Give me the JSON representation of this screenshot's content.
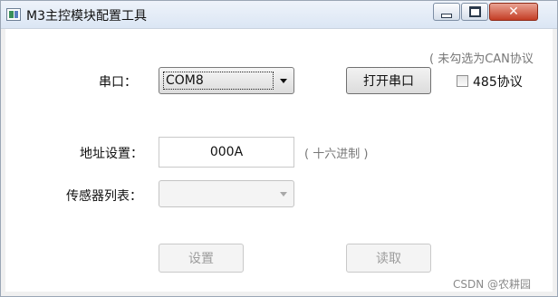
{
  "window": {
    "title": "M3主控模块配置工具",
    "controls": {
      "minimize": "minimize",
      "maximize": "maximize",
      "close": "✕"
    }
  },
  "form": {
    "protocol_hint": "( 未勾选为CAN协议",
    "serial_port": {
      "label": "串口：",
      "selected": "COM8"
    },
    "open_port_button": "打开串口",
    "protocol_485": {
      "label": "485协议",
      "checked": false
    },
    "address": {
      "label": "地址设置：",
      "value": "000A",
      "hint": "( 十六进制 )"
    },
    "sensor_list": {
      "label": "传感器列表：",
      "selected": ""
    },
    "set_button": "设置",
    "read_button": "读取"
  },
  "watermark": "CSDN @农耕园"
}
